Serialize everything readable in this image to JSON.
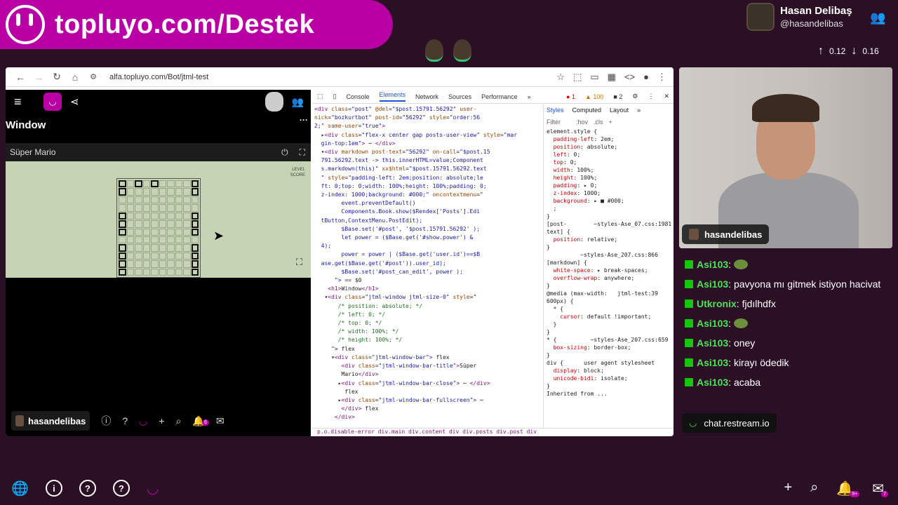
{
  "banner": {
    "text": "topluyo.com/Destek"
  },
  "profile": {
    "name": "Hasan Delibaş",
    "handle": "@hasandelibas"
  },
  "stats": {
    "up": "0.12",
    "down": "0.16"
  },
  "browser": {
    "url": "alfa.topluyo.com/Bot/jtml-test",
    "window_title": "Window",
    "window_bar_title": "Süper Mario",
    "level_label": "LEVEL",
    "score_label": "SCORE",
    "bottom_user": "hasandelibas",
    "notif_count": "6"
  },
  "devtools": {
    "tabs": [
      "Console",
      "Elements",
      "Network",
      "Sources",
      "Performance"
    ],
    "active_tab": "Elements",
    "errors": "1",
    "warnings": "100",
    "info": "2",
    "style_tabs": [
      "Styles",
      "Computed",
      "Layout"
    ],
    "filter_placeholder": "Filter",
    "filter_hov": ":hov",
    "filter_cls": ".cls",
    "breadcrumbs": "p.o.disable-error   div.main   div.content   div   div.posts   div.post   div"
  },
  "cam_label": "hasandelibas",
  "chat": [
    {
      "user": "Asi103",
      "text": "",
      "emote": true
    },
    {
      "user": "Asi103",
      "text": "pavyona mı gitmek istiyon hacivat",
      "emote": false
    },
    {
      "user": "Utkronix",
      "text": "fjdılhdfx",
      "emote": false
    },
    {
      "user": "Asi103",
      "text": "",
      "emote": true
    },
    {
      "user": "Asi103",
      "text": "oney",
      "emote": false
    },
    {
      "user": "Asi103",
      "text": "kirayı ödedik",
      "emote": false
    },
    {
      "user": "Asi103",
      "text": "acaba",
      "emote": false
    }
  ],
  "restream": "chat.restream.io",
  "taskbar": {
    "notif_badge": "9+",
    "mail_badge": "7"
  },
  "colors": {
    "brand": "#b800a4",
    "chat_user": "#4ce25a",
    "background": "#2b0f25"
  }
}
